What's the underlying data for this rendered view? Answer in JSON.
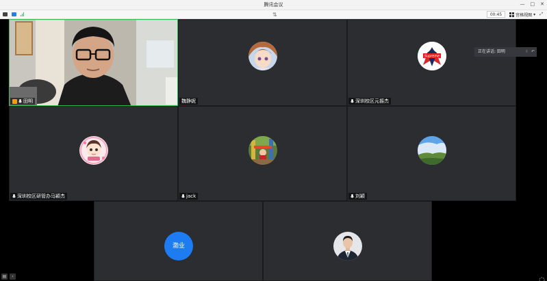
{
  "window": {
    "title": "腾讯会议"
  },
  "toolbar": {
    "timer": "00:45",
    "view_label": "宫格视图"
  },
  "speaking": {
    "label": "正在讲话: 田明"
  },
  "participants": [
    {
      "name": "田明",
      "video": true,
      "host": true
    },
    {
      "name": "魏静妮"
    },
    {
      "name": "深圳校区元振杰"
    },
    {
      "name": "深圳校区研管办马颖杰"
    },
    {
      "name": "jack"
    },
    {
      "name": "刘颖"
    },
    {
      "name": "",
      "initials": "渤业"
    },
    {
      "name": ""
    }
  ],
  "colors": {
    "active_border": "#2fbd52",
    "tile_bg": "#2b2d31",
    "initials_bg": "#1e7cf2"
  }
}
